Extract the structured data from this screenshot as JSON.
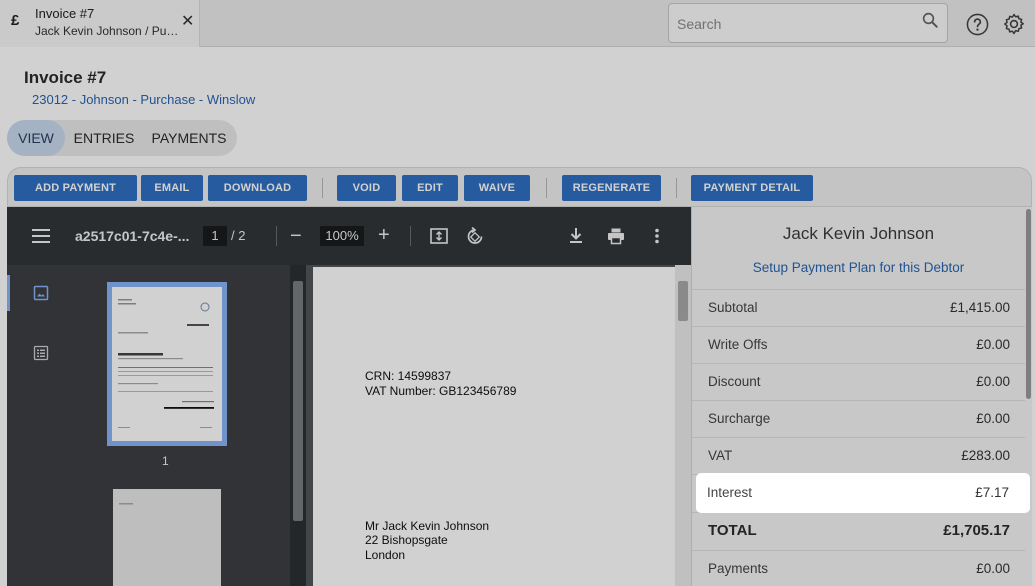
{
  "tab": {
    "icon": "£",
    "title": "Invoice #7",
    "subtitle": "Jack Kevin Johnson / Purchase"
  },
  "search": {
    "placeholder": "Search"
  },
  "header": {
    "title": "Invoice #7",
    "breadcrumb": "23012 - Johnson - Purchase - Winslow"
  },
  "view_tabs": [
    "VIEW",
    "ENTRIES",
    "PAYMENTS"
  ],
  "active_tab": "VIEW",
  "toolbar": {
    "add_payment": "ADD PAYMENT",
    "email": "EMAIL",
    "download": "DOWNLOAD",
    "void": "VOID",
    "edit": "EDIT",
    "waive": "WAIVE",
    "regenerate": "REGENERATE",
    "payment_detail": "PAYMENT DETAIL"
  },
  "pdf": {
    "filename": "a2517c01-7c4e-...",
    "page": "1",
    "page_total": "/ 2",
    "zoom": "100%",
    "thumb_label": "1",
    "doc_lines": {
      "crn": "CRN: 14599837",
      "vat": "VAT Number: GB123456789",
      "name": "Mr Jack Kevin Johnson",
      "street": "22 Bishopsgate",
      "city": "London"
    }
  },
  "summary": {
    "debtor": "Jack Kevin Johnson",
    "plan_link": "Setup Payment Plan for this Debtor",
    "rows": [
      {
        "label": "Subtotal",
        "value": "£1,415.00"
      },
      {
        "label": "Write Offs",
        "value": "£0.00"
      },
      {
        "label": "Discount",
        "value": "£0.00"
      },
      {
        "label": "Surcharge",
        "value": "£0.00"
      },
      {
        "label": "VAT",
        "value": "£283.00"
      },
      {
        "label": "Interest",
        "value": "£7.17"
      },
      {
        "label": "TOTAL",
        "value": "£1,705.17"
      },
      {
        "label": "Payments",
        "value": "£0.00"
      }
    ]
  },
  "colors": {
    "accent": "#2f70c4",
    "link": "#2a66b2",
    "pdf_toolbar": "#323639"
  }
}
